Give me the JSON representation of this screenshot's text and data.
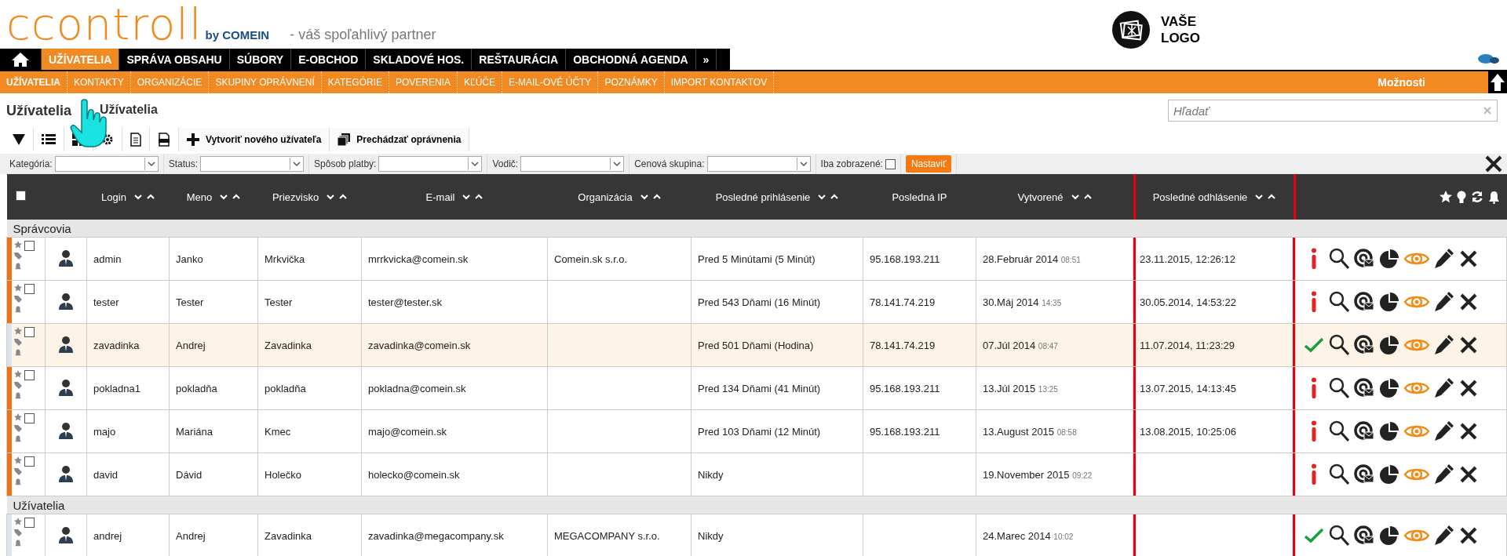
{
  "header": {
    "logo": "ccontroll",
    "logo_by": "by COMEIN",
    "tagline": "- váš spoľahlivý partner",
    "brand_text": [
      "VAŠE",
      "LOGO"
    ]
  },
  "main_nav": [
    {
      "label": "UŽÍVATELIA",
      "selected": true
    },
    {
      "label": "SPRÁVA OBSAHU",
      "selected": false
    },
    {
      "label": "SÚBORY",
      "selected": false
    },
    {
      "label": "E-OBCHOD",
      "selected": false
    },
    {
      "label": "SKLADOVÉ HOS.",
      "selected": false
    },
    {
      "label": "REŠTAURÁCIA",
      "selected": false
    },
    {
      "label": "OBCHODNÁ AGENDA",
      "selected": false
    },
    {
      "label": "»",
      "selected": false
    }
  ],
  "sub_nav": [
    {
      "label": "UŽÍVATELIA",
      "selected": true
    },
    {
      "label": "KONTAKTY",
      "selected": false
    },
    {
      "label": "ORGANIZÁCIE",
      "selected": false
    },
    {
      "label": "SKUPINY OPRÁVNENÍ",
      "selected": false
    },
    {
      "label": "KATEGÓRIE",
      "selected": false
    },
    {
      "label": "POVERENIA",
      "selected": false
    },
    {
      "label": "KĽÚČE",
      "selected": false
    },
    {
      "label": "E-MAIL-OVÉ ÚČTY",
      "selected": false
    },
    {
      "label": "POZNÁMKY",
      "selected": false
    },
    {
      "label": "IMPORT KONTAKTOV",
      "selected": false
    }
  ],
  "options_label": "Možnosti",
  "breadcrumb": [
    "Užívatelia",
    "Užívatelia"
  ],
  "search": {
    "placeholder": "Hľadať"
  },
  "toolbar": {
    "create_label": "Vytvoriť nového užívateľa",
    "permissions_label": "Prechádzať oprávnenia"
  },
  "filters": [
    {
      "label": "Kategória:"
    },
    {
      "label": "Status:"
    },
    {
      "label": "Spôsob platby:"
    },
    {
      "label": "Vodič:"
    },
    {
      "label": "Cenová skupina:"
    }
  ],
  "only_shown": {
    "label": "Iba zobrazené:",
    "checked": false
  },
  "apply_label": "Nastaviť",
  "table": {
    "all_checked": false,
    "columns": [
      {
        "label": "Login",
        "sortable": true,
        "outlined": false
      },
      {
        "label": "Meno",
        "sortable": true,
        "outlined": false
      },
      {
        "label": "Priezvisko",
        "sortable": true,
        "outlined": false
      },
      {
        "label": "E-mail",
        "sortable": true,
        "outlined": false
      },
      {
        "label": "Organizácia",
        "sortable": true,
        "outlined": false
      },
      {
        "label": "Posledné prihlásenie",
        "sortable": true,
        "outlined": false
      },
      {
        "label": "Posledná IP",
        "sortable": false,
        "outlined": false
      },
      {
        "label": "Vytvorené",
        "sortable": true,
        "outlined": false
      },
      {
        "label": "Posledné odhlásenie",
        "sortable": true,
        "outlined": true
      }
    ],
    "groups": [
      {
        "title": "Správcovia",
        "rows": [
          {
            "login": "admin",
            "name": "Janko",
            "surname": "Mrkvička",
            "email": "mrrkvicka@comein.sk",
            "organization": "Comein.sk s.r.o.",
            "last_login": "Pred 5 Minútami (5 Minút)",
            "last_ip": "95.168.193.211",
            "created_date": "28.Február 2014",
            "created_time": "08:51",
            "last_logout": "23.11.2015, 12:26:12",
            "flagged": true,
            "highlighted": false,
            "checked": false,
            "confirmed": false
          },
          {
            "login": "tester",
            "name": "Tester",
            "surname": "Tester",
            "email": "tester@tester.sk",
            "organization": "",
            "last_login": "Pred 543 Dňami (16 Minút)",
            "last_ip": "78.141.74.219",
            "created_date": "30.Máj 2014",
            "created_time": "14:35",
            "last_logout": "30.05.2014, 14:53:22",
            "flagged": true,
            "highlighted": false,
            "checked": false,
            "confirmed": false
          },
          {
            "login": "zavadinka",
            "name": "Andrej",
            "surname": "Zavadinka",
            "email": "zavadinka@comein.sk",
            "organization": "",
            "last_login": "Pred 501 Dňami (Hodina)",
            "last_ip": "78.141.74.219",
            "created_date": "07.Júl 2014",
            "created_time": "08:47",
            "last_logout": "11.07.2014, 11:23:29",
            "flagged": false,
            "highlighted": true,
            "checked": false,
            "confirmed": true
          },
          {
            "login": "pokladna1",
            "name": "pokladňa",
            "surname": "pokladňa",
            "email": "pokladna@comein.sk",
            "organization": "",
            "last_login": "Pred 134 Dňami (41 Minút)",
            "last_ip": "95.168.193.211",
            "created_date": "13.Júl 2015",
            "created_time": "13:25",
            "last_logout": "13.07.2015, 14:13:45",
            "flagged": true,
            "highlighted": false,
            "checked": false,
            "confirmed": false
          },
          {
            "login": "majo",
            "name": "Mariána",
            "surname": "Kmec",
            "email": "majo@comein.sk",
            "organization": "",
            "last_login": "Pred 103 Dňami (12 Minút)",
            "last_ip": "95.168.193.211",
            "created_date": "13.August 2015",
            "created_time": "08:58",
            "last_logout": "13.08.2015, 10:25:06",
            "flagged": true,
            "highlighted": false,
            "checked": false,
            "confirmed": false
          },
          {
            "login": "david",
            "name": "Dávid",
            "surname": "Holečko",
            "email": "holecko@comein.sk",
            "organization": "",
            "last_login": "Nikdy",
            "last_ip": "",
            "created_date": "19.November 2015",
            "created_time": "09:22",
            "last_logout": "",
            "flagged": true,
            "highlighted": false,
            "checked": false,
            "confirmed": false
          }
        ]
      },
      {
        "title": "Užívatelia",
        "rows": [
          {
            "login": "andrej",
            "name": "Andrej",
            "surname": "Zavadinka",
            "email": "zavadinka@megacompany.sk",
            "organization": "MEGACOMPANY s.r.o.",
            "last_login": "Nikdy",
            "last_ip": "",
            "created_date": "24.Marec 2014",
            "created_time": "10:02",
            "last_logout": "",
            "flagged": false,
            "highlighted": false,
            "checked": false,
            "confirmed": true
          }
        ]
      }
    ]
  }
}
